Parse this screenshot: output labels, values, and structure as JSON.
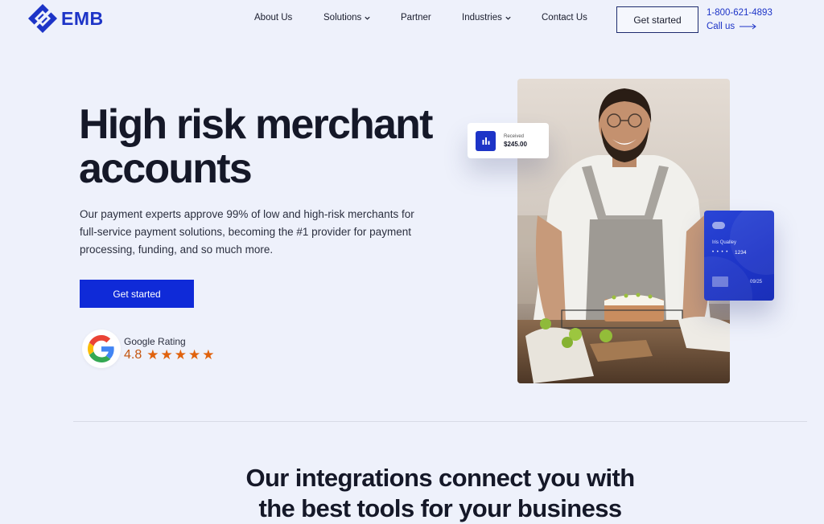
{
  "brand": {
    "name": "EMB",
    "color": "#1d34c7"
  },
  "nav": {
    "items": [
      {
        "label": "About Us",
        "has_dropdown": false
      },
      {
        "label": "Solutions",
        "has_dropdown": true
      },
      {
        "label": "Partner",
        "has_dropdown": false
      },
      {
        "label": "Industries",
        "has_dropdown": true
      },
      {
        "label": "Contact Us",
        "has_dropdown": false
      }
    ],
    "cta_label": "Get started",
    "phone": "1-800-621-4893",
    "call_label": "Call us"
  },
  "hero": {
    "title": "High risk merchant accounts",
    "description": "Our payment experts approve 99% of low and high-risk merchants for full-service payment solutions, becoming the #1 provider for payment processing, funding, and so much more.",
    "cta_label": "Get started",
    "cta_color": "#0f2ad8"
  },
  "rating": {
    "label": "Google Rating",
    "score": "4.8",
    "stars": 5,
    "star_color": "#e0620d"
  },
  "received_card": {
    "label": "Received",
    "amount": "$245.00"
  },
  "credit_card": {
    "name": "Iris Qualley",
    "masked": "• • • •",
    "last4": "1234",
    "expiry": "09/25"
  },
  "integrations": {
    "title_line1": "Our integrations connect you with",
    "title_line2": "the best tools for your business"
  }
}
